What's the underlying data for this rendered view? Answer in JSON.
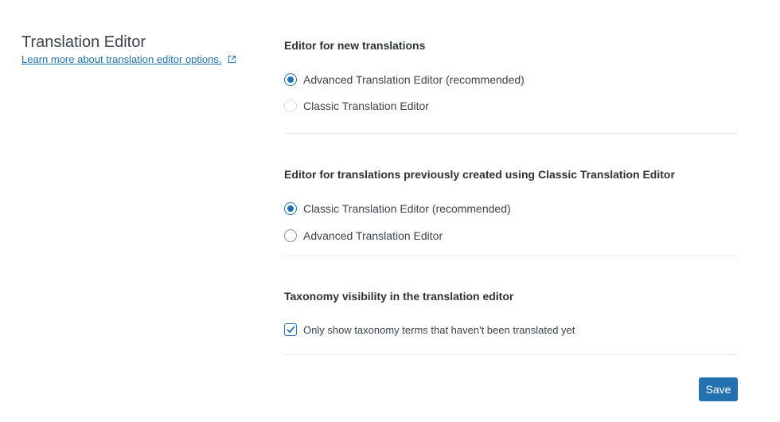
{
  "header": {
    "title": "Translation Editor",
    "learn_more_link": "Learn more about translation editor options."
  },
  "sections": [
    {
      "title": "Editor for new translations",
      "options": [
        {
          "label": "Advanced Translation Editor (recommended)",
          "selected": true
        },
        {
          "label": "Classic Translation Editor",
          "selected": false
        }
      ]
    },
    {
      "title": "Editor for translations previously created using Classic Translation Editor",
      "options": [
        {
          "label": "Classic Translation Editor (recommended)",
          "selected": true
        },
        {
          "label": "Advanced Translation Editor",
          "selected": false
        }
      ]
    },
    {
      "title": "Taxonomy visibility in the translation editor",
      "checkbox": {
        "label": "Only show taxonomy terms that haven't been translated yet",
        "checked": true
      }
    }
  ],
  "actions": {
    "save_label": "Save"
  },
  "colors": {
    "accent": "#2271b1",
    "divider": "#e4e6e8",
    "text": "#2c3338"
  }
}
